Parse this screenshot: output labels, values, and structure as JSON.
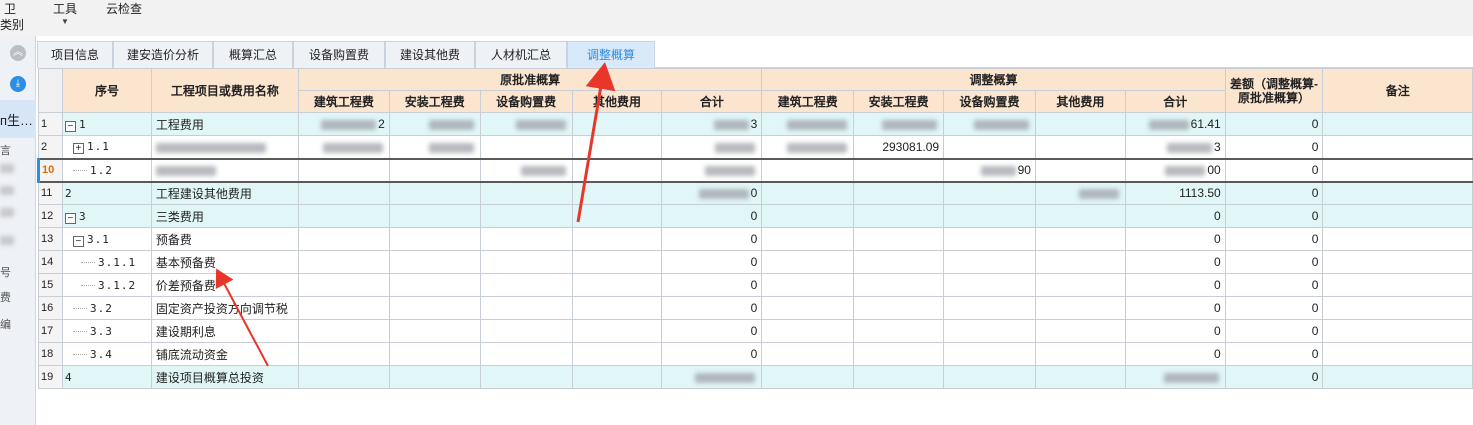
{
  "menubar": {
    "items": [
      {
        "label": "卫",
        "sub": "类别"
      },
      {
        "label": "工具",
        "sub": ""
      },
      {
        "label": "云检查",
        "sub": ""
      }
    ]
  },
  "leftstrip": {
    "selected_label": "п生…",
    "fragments": [
      "言",
      "号",
      "费",
      "编"
    ]
  },
  "tabs": [
    {
      "label": "项目信息",
      "active": false
    },
    {
      "label": "建安造价分析",
      "active": false
    },
    {
      "label": "概算汇总",
      "active": false
    },
    {
      "label": "设备购置费",
      "active": false
    },
    {
      "label": "建设其他费",
      "active": false
    },
    {
      "label": "人材机汇总",
      "active": false
    },
    {
      "label": "调整概算",
      "active": true
    }
  ],
  "grid": {
    "headers": {
      "seq": "序号",
      "name": "工程项目或费用名称",
      "original_group": "原批准概算",
      "adjusted_group": "调整概算",
      "diff": "差额（调整概算-原批准概算）",
      "remark": "备注",
      "sub": [
        "建筑工程费",
        "安装工程费",
        "设备购置费",
        "其他费用",
        "合计"
      ]
    },
    "rows": [
      {
        "rn": "1",
        "seq": "1",
        "tree": "minus",
        "indent": 0,
        "name": "工程费用",
        "orig": [
          "2",
          "",
          "",
          "",
          "3"
        ],
        "adj": [
          "",
          "",
          "",
          "",
          "61.41"
        ],
        "diff": "0",
        "cyan": true
      },
      {
        "rn": "2",
        "seq": "1.1",
        "tree": "plus",
        "indent": 1,
        "name": "",
        "orig": [
          "",
          "",
          "",
          "",
          ""
        ],
        "adj": [
          "",
          "293081.09",
          "",
          "",
          "3"
        ],
        "diff": "0",
        "cyan": false
      },
      {
        "rn": "10",
        "seq": "1.2",
        "tree": "leaf",
        "indent": 1,
        "name": "",
        "orig": [
          "",
          "",
          "",
          "",
          ""
        ],
        "adj": [
          "",
          "",
          "90",
          "",
          "00"
        ],
        "diff": "0",
        "cyan": false,
        "selected": true
      },
      {
        "rn": "11",
        "seq": "2",
        "tree": "none",
        "indent": 0,
        "name": "工程建设其他费用",
        "orig": [
          "",
          "",
          "",
          "",
          "0"
        ],
        "adj": [
          "",
          "",
          "",
          "",
          "1113.50"
        ],
        "diff": "0",
        "cyan": true
      },
      {
        "rn": "12",
        "seq": "3",
        "tree": "minus",
        "indent": 0,
        "name": "三类费用",
        "orig": [
          "",
          "",
          "",
          "",
          "0"
        ],
        "adj": [
          "",
          "",
          "",
          "",
          "0"
        ],
        "diff": "0",
        "cyan": true
      },
      {
        "rn": "13",
        "seq": "3.1",
        "tree": "minus",
        "indent": 1,
        "name": "预备费",
        "orig": [
          "",
          "",
          "",
          "",
          "0"
        ],
        "adj": [
          "",
          "",
          "",
          "",
          "0"
        ],
        "diff": "0",
        "cyan": false
      },
      {
        "rn": "14",
        "seq": "3.1.1",
        "tree": "leaf",
        "indent": 2,
        "name": "基本预备费",
        "orig": [
          "",
          "",
          "",
          "",
          "0"
        ],
        "adj": [
          "",
          "",
          "",
          "",
          "0"
        ],
        "diff": "0",
        "cyan": false
      },
      {
        "rn": "15",
        "seq": "3.1.2",
        "tree": "leaf",
        "indent": 2,
        "name": "价差预备费",
        "orig": [
          "",
          "",
          "",
          "",
          "0"
        ],
        "adj": [
          "",
          "",
          "",
          "",
          "0"
        ],
        "diff": "0",
        "cyan": false
      },
      {
        "rn": "16",
        "seq": "3.2",
        "tree": "leaf",
        "indent": 1,
        "name": "固定资产投资方向调节税",
        "orig": [
          "",
          "",
          "",
          "",
          "0"
        ],
        "adj": [
          "",
          "",
          "",
          "",
          "0"
        ],
        "diff": "0",
        "cyan": false
      },
      {
        "rn": "17",
        "seq": "3.3",
        "tree": "leaf",
        "indent": 1,
        "name": "建设期利息",
        "orig": [
          "",
          "",
          "",
          "",
          "0"
        ],
        "adj": [
          "",
          "",
          "",
          "",
          "0"
        ],
        "diff": "0",
        "cyan": false
      },
      {
        "rn": "18",
        "seq": "3.4",
        "tree": "leaf",
        "indent": 1,
        "name": "铺底流动资金",
        "orig": [
          "",
          "",
          "",
          "",
          "0"
        ],
        "adj": [
          "",
          "",
          "",
          "",
          "0"
        ],
        "diff": "0",
        "cyan": false
      },
      {
        "rn": "19",
        "seq": "4",
        "tree": "none",
        "indent": 0,
        "name": "建设项目概算总投资",
        "orig": [
          "",
          "",
          "",
          "",
          ""
        ],
        "adj": [
          "",
          "",
          "",
          "",
          ""
        ],
        "diff": "0",
        "cyan": true
      }
    ]
  },
  "colors": {
    "header_bg": "#fce5cf",
    "cyan_row": "#e0f6f7",
    "active_tab_text": "#2d8ce0",
    "arrow": "#e8362b"
  },
  "icons": {
    "collapse": "double-chevron-up-icon",
    "download": "download-circle-icon"
  }
}
